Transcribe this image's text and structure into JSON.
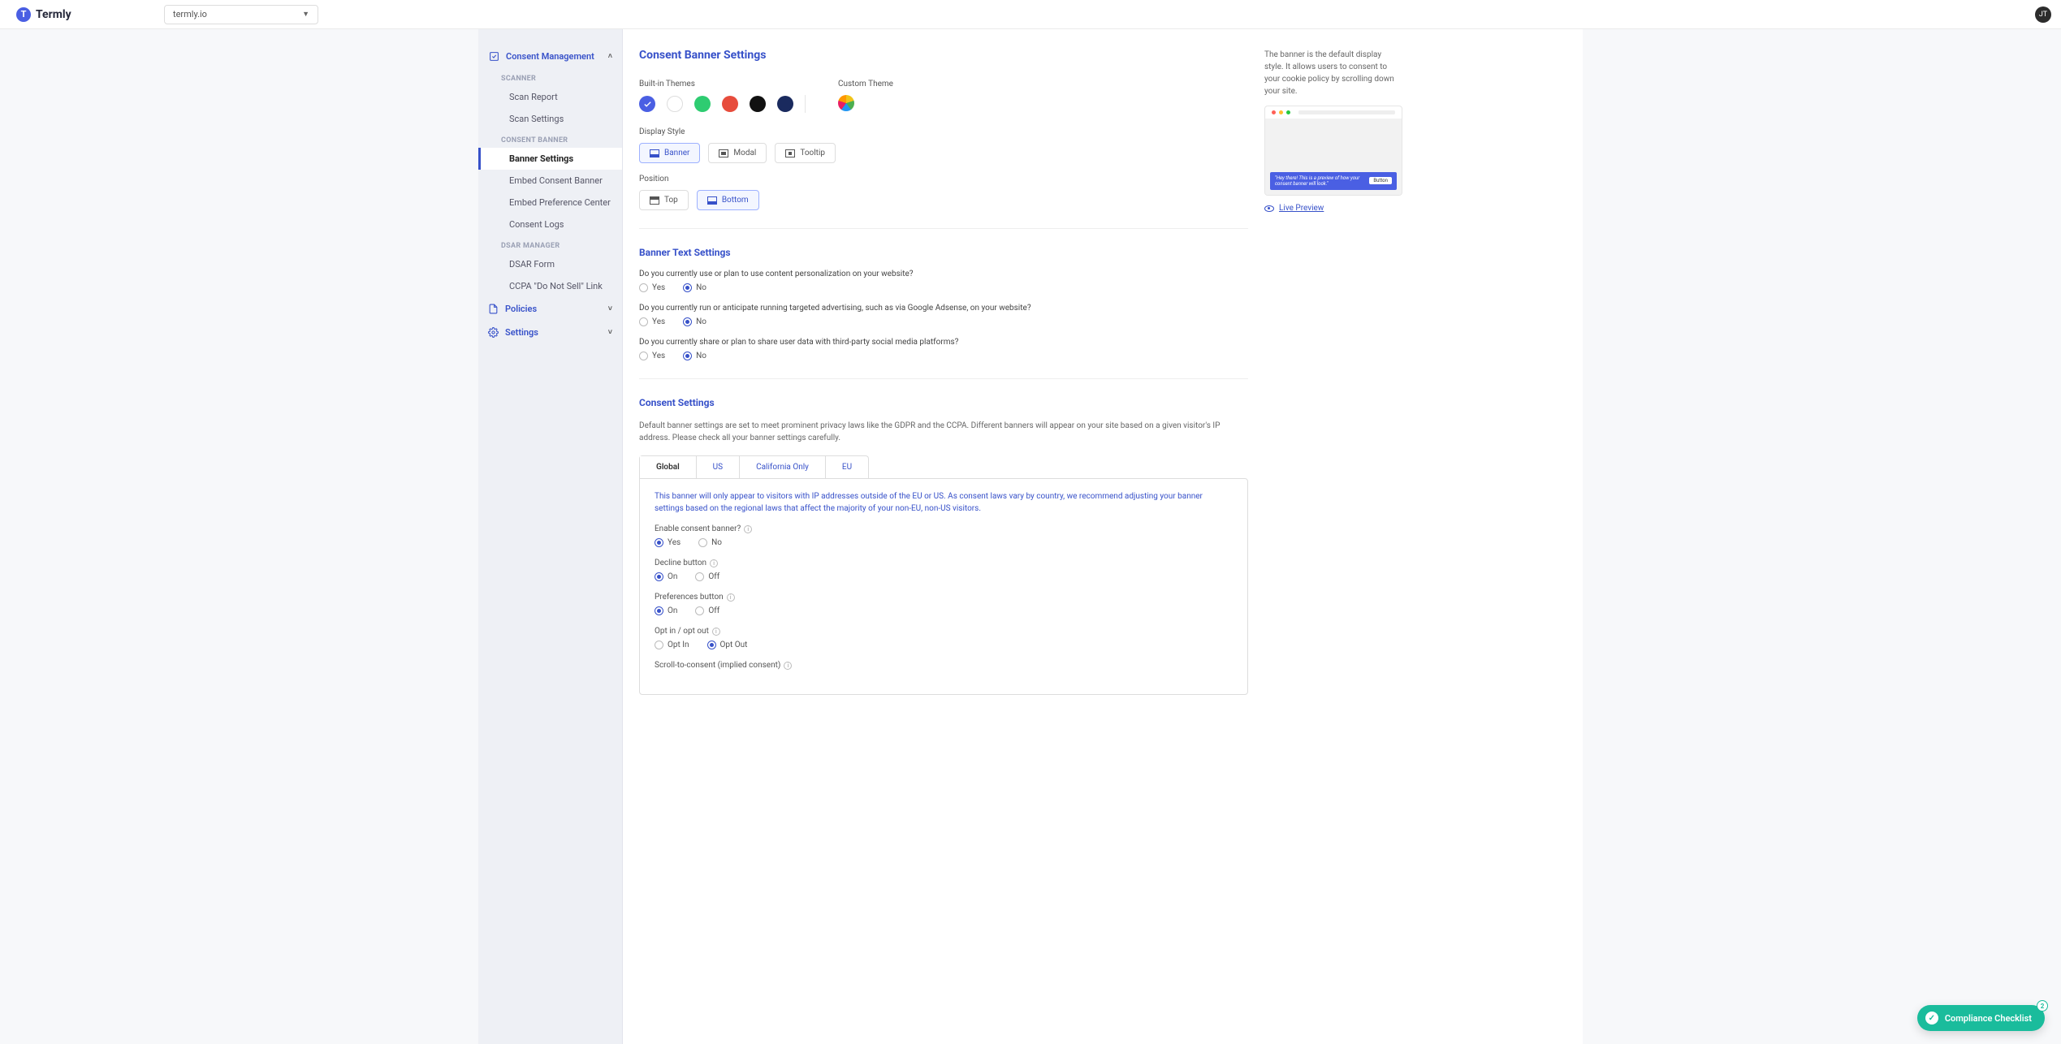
{
  "header": {
    "brand": "Termly",
    "site_selector": {
      "selected": "termly.io"
    },
    "avatar_initials": "JT"
  },
  "sidebar": {
    "consent_management": {
      "label": "Consent Management",
      "scanner_group": "SCANNER",
      "scanner_items": [
        {
          "label": "Scan Report"
        },
        {
          "label": "Scan Settings"
        }
      ],
      "banner_group": "CONSENT BANNER",
      "banner_items": [
        {
          "label": "Banner Settings",
          "active": true
        },
        {
          "label": "Embed Consent Banner"
        },
        {
          "label": "Embed Preference Center"
        },
        {
          "label": "Consent Logs"
        }
      ],
      "dsar_group": "DSAR MANAGER",
      "dsar_items": [
        {
          "label": "DSAR Form"
        },
        {
          "label": "CCPA \"Do Not Sell\" Link"
        }
      ]
    },
    "policies": {
      "label": "Policies"
    },
    "settings": {
      "label": "Settings"
    }
  },
  "page": {
    "title": "Consent Banner Settings",
    "themes": {
      "builtin_label": "Built-in Themes",
      "custom_label": "Custom Theme",
      "colors": [
        {
          "hex": "#4a5fe3",
          "selected": true
        },
        {
          "hex": "#ffffff",
          "border": true
        },
        {
          "hex": "#2ecc71"
        },
        {
          "hex": "#e74c3c"
        },
        {
          "hex": "#111111"
        },
        {
          "hex": "#1a2a5e"
        }
      ]
    },
    "display_style": {
      "label": "Display Style",
      "options": [
        {
          "label": "Banner",
          "icon": "banner",
          "selected": true
        },
        {
          "label": "Modal",
          "icon": "modal"
        },
        {
          "label": "Tooltip",
          "icon": "tooltip"
        }
      ]
    },
    "position": {
      "label": "Position",
      "options": [
        {
          "label": "Top",
          "icon": "top"
        },
        {
          "label": "Bottom",
          "icon": "banner",
          "selected": true
        }
      ]
    },
    "banner_text": {
      "heading": "Banner Text Settings",
      "questions": [
        {
          "text": "Do you currently use or plan to use content personalization on your website?",
          "yes": "Yes",
          "no": "No",
          "value": "No"
        },
        {
          "text": "Do you currently run or anticipate running targeted advertising, such as via Google Adsense, on your website?",
          "yes": "Yes",
          "no": "No",
          "value": "No"
        },
        {
          "text": "Do you currently share or plan to share user data with third-party social media platforms?",
          "yes": "Yes",
          "no": "No",
          "value": "No"
        }
      ]
    },
    "consent_settings": {
      "heading": "Consent Settings",
      "desc": "Default banner settings are set to meet prominent privacy laws like the GDPR and the CCPA. Different banners will appear on your site based on a given visitor's IP address. Please check all your banner settings carefully.",
      "tabs": [
        {
          "label": "Global",
          "active": true
        },
        {
          "label": "US"
        },
        {
          "label": "California Only"
        },
        {
          "label": "EU"
        }
      ],
      "global": {
        "help": "This banner will only appear to visitors with IP addresses outside of the EU or US. As consent laws vary by country, we recommend adjusting your banner settings based on the regional laws that affect the majority of your non-EU, non-US visitors.",
        "enable": {
          "label": "Enable consent banner?",
          "yes": "Yes",
          "no": "No",
          "value": "Yes"
        },
        "decline": {
          "label": "Decline button",
          "on": "On",
          "off": "Off",
          "value": "On"
        },
        "prefs": {
          "label": "Preferences button",
          "on": "On",
          "off": "Off",
          "value": "On"
        },
        "optinout": {
          "label": "Opt in / opt out",
          "in": "Opt In",
          "out": "Opt Out",
          "value": "Opt Out"
        },
        "scroll": {
          "label": "Scroll-to-consent (implied consent)"
        }
      }
    }
  },
  "right_panel": {
    "help": "The banner is the default display style. It allows users to consent to your cookie policy by scrolling down your site.",
    "preview_text": "\"Hey there! This is a preview of how your consent banner will look.\"",
    "preview_button": "Button",
    "live_preview": "Live Preview"
  },
  "compliance_pill": {
    "label": "Compliance Checklist",
    "badge": "2"
  }
}
